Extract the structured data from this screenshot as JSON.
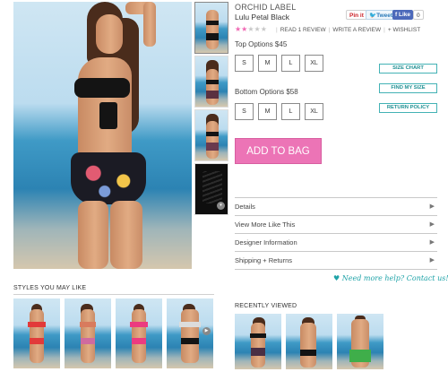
{
  "product": {
    "brand": "ORCHID LABEL",
    "name": "Lulu Petal Black",
    "rating_filled": 2,
    "rating_total": 5,
    "links": [
      "READ 1 REVIEW",
      "WRITE A REVIEW",
      "+ WISHLIST"
    ]
  },
  "social": {
    "pin": "Pin it",
    "tweet": "Tweet",
    "like": "Like",
    "like_count": "0"
  },
  "top_options": {
    "label": "Top Options $45",
    "sizes": [
      "S",
      "M",
      "L",
      "XL"
    ]
  },
  "bottom_options": {
    "label": "Bottom Options $58",
    "sizes": [
      "S",
      "M",
      "L",
      "XL"
    ]
  },
  "side_buttons": {
    "size_chart": "SIZE CHART",
    "find_size": "FIND MY SIZE",
    "return_policy": "RETURN POLICY"
  },
  "add_to_bag": "ADD TO BAG",
  "accordion": [
    {
      "label": "Details",
      "arrow": "▶"
    },
    {
      "label": "View More Like This",
      "arrow": "▶"
    },
    {
      "label": "Designer Information",
      "arrow": "▶"
    },
    {
      "label": "Shipping + Returns",
      "arrow": "▶"
    }
  ],
  "help": {
    "icon": "heart-icon",
    "text": "Need more help? Contact us!"
  },
  "styles_title": "STYLES YOU MAY LIKE",
  "recently_title": "RECENTLY VIEWED",
  "colors": {
    "accent_pink": "#ec74b6",
    "accent_teal": "#43b2b5"
  }
}
